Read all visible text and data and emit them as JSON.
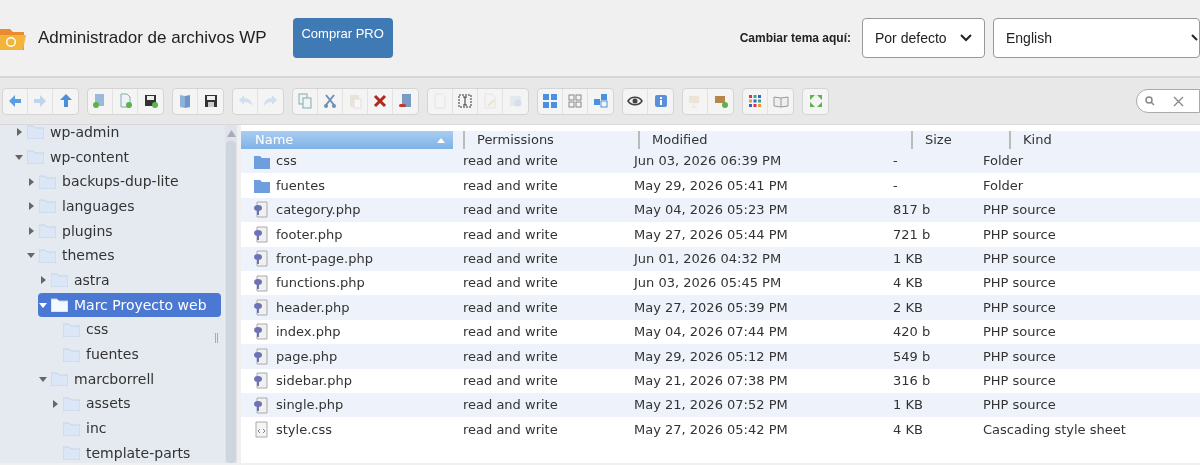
{
  "header": {
    "title": "Administrador de archivos WP",
    "buy_button": "Comprar PRO",
    "theme_label": "Cambiar tema aquí:",
    "theme_select": "Por defecto",
    "language_select": "English"
  },
  "toolbar": [
    {
      "tools": [
        {
          "kind": "back",
          "disabled": false
        },
        {
          "kind": "forward",
          "disabled": true
        },
        {
          "kind": "up",
          "disabled": false
        }
      ]
    },
    {
      "tools": [
        {
          "kind": "new-folder",
          "disabled": false
        },
        {
          "kind": "new-file",
          "disabled": false
        },
        {
          "kind": "upload",
          "disabled": false
        }
      ]
    },
    {
      "tools": [
        {
          "kind": "open",
          "disabled": false
        },
        {
          "kind": "save",
          "disabled": false
        }
      ]
    },
    {
      "tools": [
        {
          "kind": "undo",
          "disabled": true
        },
        {
          "kind": "redo",
          "disabled": true
        }
      ]
    },
    {
      "tools": [
        {
          "kind": "copy",
          "disabled": false
        },
        {
          "kind": "cut",
          "disabled": false
        },
        {
          "kind": "paste",
          "disabled": true
        },
        {
          "kind": "delete",
          "disabled": false
        },
        {
          "kind": "empty",
          "disabled": false
        }
      ]
    },
    {
      "tools": [
        {
          "kind": "duplicate",
          "disabled": true
        },
        {
          "kind": "rename",
          "disabled": false
        },
        {
          "kind": "edit",
          "disabled": true
        },
        {
          "kind": "resize",
          "disabled": true
        }
      ]
    },
    {
      "tools": [
        {
          "kind": "icons-view",
          "disabled": false
        },
        {
          "kind": "grid-view",
          "disabled": false
        },
        {
          "kind": "list-view",
          "disabled": false
        }
      ]
    },
    {
      "tools": [
        {
          "kind": "preview",
          "disabled": false
        },
        {
          "kind": "info",
          "disabled": false
        }
      ]
    },
    {
      "tools": [
        {
          "kind": "archive",
          "disabled": true
        },
        {
          "kind": "extract",
          "disabled": false
        }
      ]
    },
    {
      "tools": [
        {
          "kind": "sort",
          "disabled": false
        },
        {
          "kind": "help",
          "disabled": false
        }
      ]
    },
    {
      "tools": [
        {
          "kind": "fullscreen",
          "disabled": false
        }
      ]
    }
  ],
  "tree": [
    {
      "label": "wp-admin",
      "expanded": false,
      "selected": false
    },
    {
      "label": "wp-content",
      "expanded": true,
      "selected": false,
      "children": [
        {
          "label": "backups-dup-lite",
          "expanded": false,
          "selected": false
        },
        {
          "label": "languages",
          "expanded": false,
          "selected": false
        },
        {
          "label": "plugins",
          "expanded": false,
          "selected": false
        },
        {
          "label": "themes",
          "expanded": true,
          "selected": false,
          "children": [
            {
              "label": "astra",
              "expanded": false,
              "selected": false
            },
            {
              "label": "Marc Proyecto web",
              "expanded": true,
              "selected": true,
              "children": [
                {
                  "label": "css",
                  "selected": false
                },
                {
                  "label": "fuentes",
                  "selected": false
                }
              ]
            },
            {
              "label": "marcborrell",
              "expanded": true,
              "selected": false,
              "children": [
                {
                  "label": "assets",
                  "expanded": false,
                  "selected": false
                },
                {
                  "label": "inc",
                  "selected": false
                },
                {
                  "label": "template-parts",
                  "selected": false
                }
              ]
            }
          ]
        }
      ]
    }
  ],
  "table": {
    "columns": [
      {
        "label": "Name",
        "sorted": true
      },
      {
        "label": "Permissions",
        "sorted": false
      },
      {
        "label": "Modified",
        "sorted": false
      },
      {
        "label": "Size",
        "sorted": false
      },
      {
        "label": "Kind",
        "sorted": false
      }
    ],
    "rows": [
      {
        "kind": "folder",
        "name": "css",
        "permissions": "read and write",
        "modified": "Jun 03, 2026 06:39 PM",
        "size": "-",
        "file_kind": "Folder"
      },
      {
        "kind": "folder",
        "name": "fuentes",
        "permissions": "read and write",
        "modified": "May 29, 2026 05:41 PM",
        "size": "-",
        "file_kind": "Folder"
      },
      {
        "kind": "php",
        "name": "category.php",
        "permissions": "read and write",
        "modified": "May 04, 2026 05:23 PM",
        "size": "817 b",
        "file_kind": "PHP source"
      },
      {
        "kind": "php",
        "name": "footer.php",
        "permissions": "read and write",
        "modified": "May 27, 2026 05:44 PM",
        "size": "721 b",
        "file_kind": "PHP source"
      },
      {
        "kind": "php",
        "name": "front-page.php",
        "permissions": "read and write",
        "modified": "Jun 01, 2026 04:32 PM",
        "size": "1 KB",
        "file_kind": "PHP source"
      },
      {
        "kind": "php",
        "name": "functions.php",
        "permissions": "read and write",
        "modified": "Jun 03, 2026 05:45 PM",
        "size": "4 KB",
        "file_kind": "PHP source"
      },
      {
        "kind": "php",
        "name": "header.php",
        "permissions": "read and write",
        "modified": "May 27, 2026 05:39 PM",
        "size": "2 KB",
        "file_kind": "PHP source"
      },
      {
        "kind": "php",
        "name": "index.php",
        "permissions": "read and write",
        "modified": "May 04, 2026 07:44 PM",
        "size": "420 b",
        "file_kind": "PHP source"
      },
      {
        "kind": "php",
        "name": "page.php",
        "permissions": "read and write",
        "modified": "May 29, 2026 05:12 PM",
        "size": "549 b",
        "file_kind": "PHP source"
      },
      {
        "kind": "php",
        "name": "sidebar.php",
        "permissions": "read and write",
        "modified": "May 21, 2026 07:38 PM",
        "size": "316 b",
        "file_kind": "PHP source"
      },
      {
        "kind": "php",
        "name": "single.php",
        "permissions": "read and write",
        "modified": "May 21, 2026 07:52 PM",
        "size": "1 KB",
        "file_kind": "PHP source"
      },
      {
        "kind": "css",
        "name": "style.css",
        "permissions": "read and write",
        "modified": "May 27, 2026 05:42 PM",
        "size": "4 KB",
        "file_kind": "Cascading style sheet"
      }
    ]
  }
}
